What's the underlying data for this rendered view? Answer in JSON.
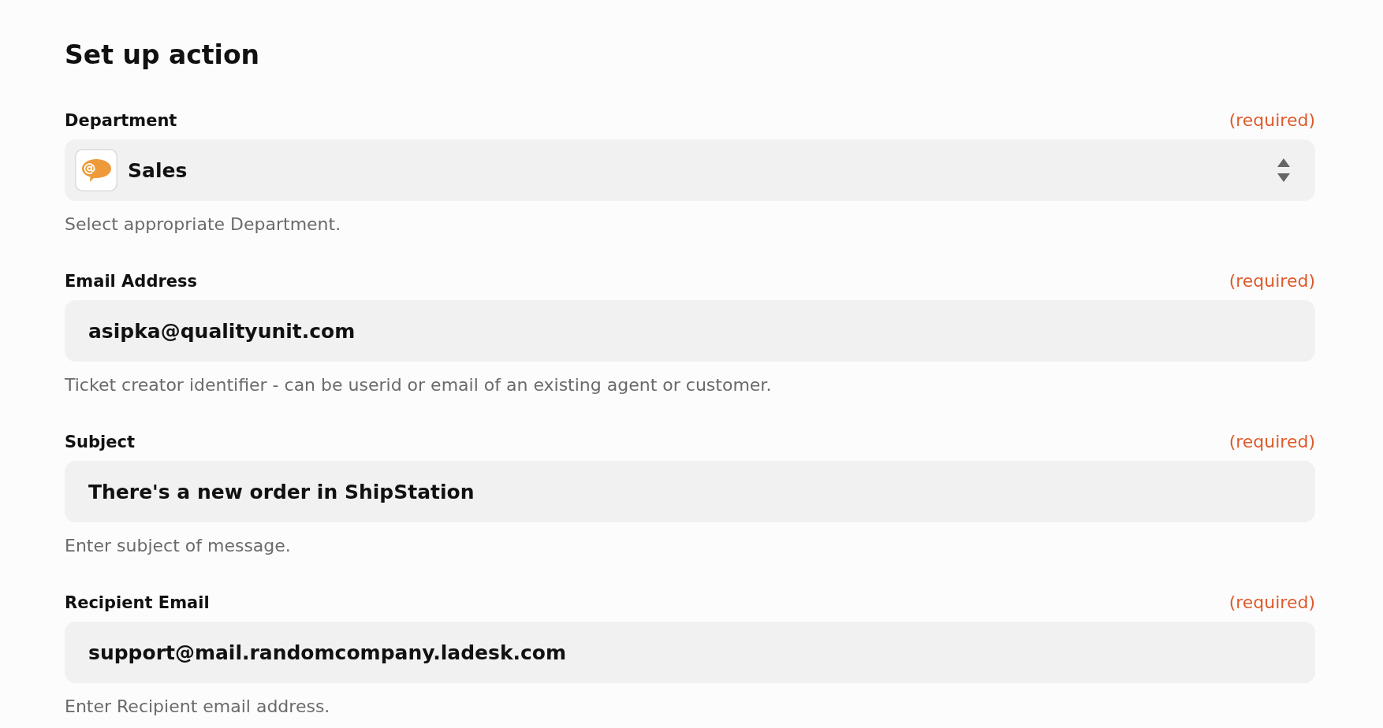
{
  "heading": "Set up action",
  "fields": [
    {
      "kind": "select",
      "label": "Department",
      "note": "(required)",
      "value": "Sales",
      "help": "Select appropriate Department."
    },
    {
      "kind": "text",
      "label": "Email Address",
      "note": "(required)",
      "value": "asipka@qualityunit.com",
      "help": "Ticket creator identifier - can be userid or email of an existing agent or customer."
    },
    {
      "kind": "text",
      "label": "Subject",
      "note": "(required)",
      "value": "There's a new order in ShipStation",
      "help": "Enter subject of message."
    },
    {
      "kind": "text",
      "label": "Recipient Email",
      "note": "(required)",
      "value": "support@mail.randomcompany.ladesk.com",
      "help": "Enter Recipient email address."
    }
  ]
}
